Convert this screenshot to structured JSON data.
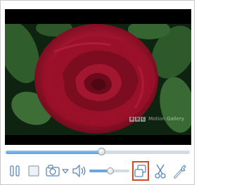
{
  "video": {
    "watermark_logo": "BBC",
    "watermark_text": "Motion Gallery"
  },
  "playback": {
    "progress_fraction": 0.52,
    "volume_fraction": 0.52
  },
  "controls": {
    "pause": "pause-icon",
    "stop": "stop-icon",
    "snapshot": "camera-icon",
    "snapshot_menu": "chevron-down-icon",
    "volume": "speaker-icon",
    "pip": "picture-in-picture-icon",
    "clip": "scissors-icon",
    "tools": "wrench-icon"
  },
  "colors": {
    "accent": "#5a9ddc",
    "icon": "#5b87b5",
    "highlight": "#d2491f"
  }
}
